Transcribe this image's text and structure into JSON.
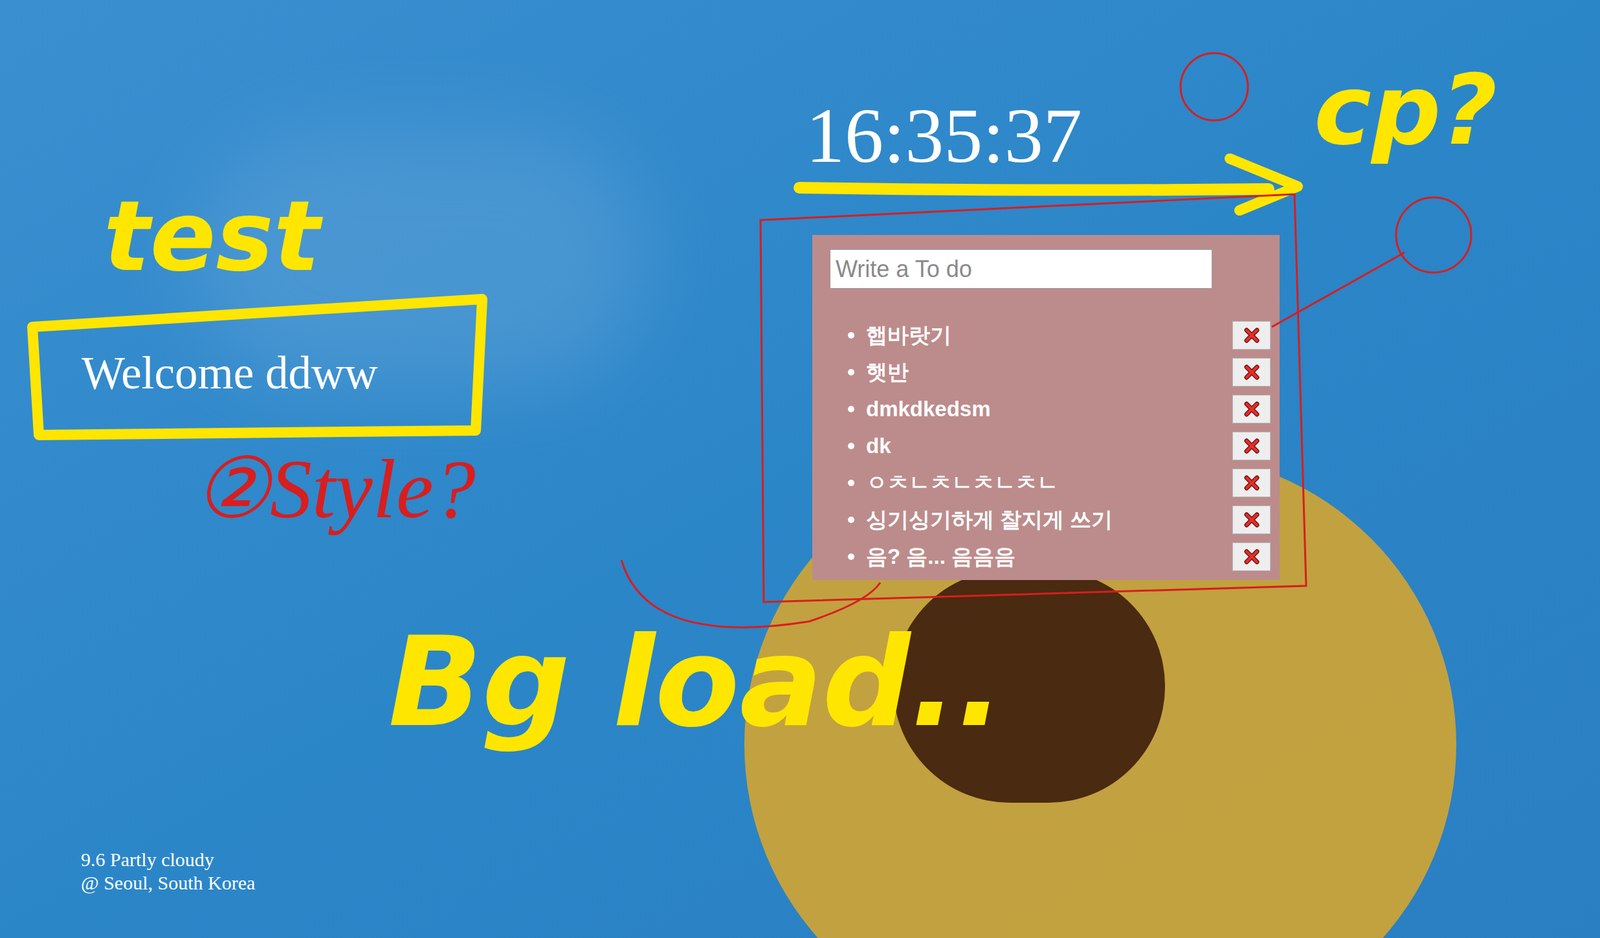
{
  "clock": {
    "time": "16:35:37"
  },
  "greeting": {
    "text": "Welcome ddww"
  },
  "todo": {
    "placeholder": "Write a To do",
    "items": [
      {
        "text": "햅바랏기"
      },
      {
        "text": "햇반"
      },
      {
        "text": "dmkdkedsm"
      },
      {
        "text": "dk"
      },
      {
        "text": "ㅇㅊㄴㅊㄴㅊㄴㅊㄴ"
      },
      {
        "text": "싱기싱기하게 찰지게 쓰기"
      },
      {
        "text": "음? 음... 음음음"
      }
    ]
  },
  "weather": {
    "condition": "9.6 Partly cloudy",
    "location": "@ Seoul, South Korea"
  },
  "annotations": [
    {
      "text": "test",
      "color": "#ffe600"
    },
    {
      "text": "cp?",
      "color": "#ffe600"
    },
    {
      "text": "Bg load..",
      "color": "#ffe600"
    },
    {
      "text": "②Style?",
      "color": "#d81e1e"
    }
  ]
}
